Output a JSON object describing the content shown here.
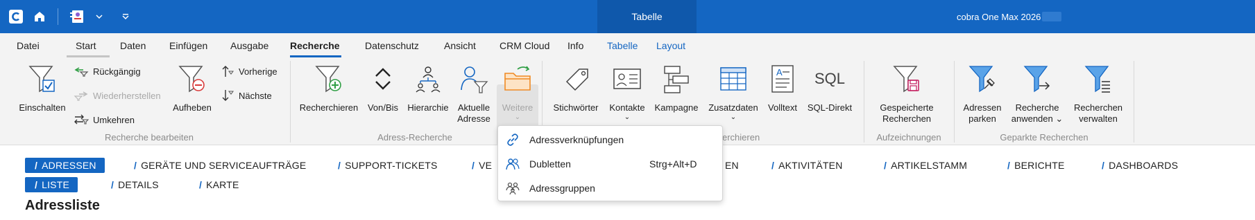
{
  "titlebar": {
    "context_header": "Tabelle",
    "app_title": "cobra One Max 2026"
  },
  "menu_tabs": [
    {
      "label": "Datei"
    },
    {
      "label": "Start"
    },
    {
      "label": "Daten"
    },
    {
      "label": "Einfügen"
    },
    {
      "label": "Ausgabe"
    },
    {
      "label": "Recherche"
    },
    {
      "label": "Datenschutz"
    },
    {
      "label": "Ansicht"
    },
    {
      "label": "CRM Cloud"
    },
    {
      "label": "Info"
    },
    {
      "label": "Tabelle"
    },
    {
      "label": "Layout"
    }
  ],
  "ribbon": {
    "recherche_bearbeiten": {
      "label": "Recherche bearbeiten",
      "einschalten": "Einschalten",
      "rueckgaengig": "Rückgängig",
      "wiederherstellen": "Wiederherstellen",
      "umkehren": "Umkehren",
      "aufheben": "Aufheben",
      "vorherige": "Vorherige",
      "naechste": "Nächste"
    },
    "adress_recherche": {
      "label": "Adress-Recherche",
      "recherchieren": "Recherchieren",
      "von_bis": "Von/Bis",
      "hierarchie": "Hierarchie",
      "aktuelle_adresse_1": "Aktuelle",
      "aktuelle_adresse_2": "Adresse",
      "weitere": "Weitere"
    },
    "weitere_recherchieren": {
      "label_visible": "erchieren",
      "stichwoerter": "Stichwörter",
      "kontakte": "Kontakte",
      "kampagne": "Kampagne",
      "zusatzdaten": "Zusatzdaten",
      "volltext": "Volltext",
      "sql_direkt": "SQL-Direkt",
      "sql_icon_text": "SQL"
    },
    "aufzeichnungen": {
      "label": "Aufzeichnungen",
      "gespeicherte_1": "Gespeicherte",
      "gespeicherte_2": "Recherchen"
    },
    "geparkte_recherchen": {
      "label": "Geparkte Recherchen",
      "adressen_parken_1": "Adressen",
      "adressen_parken_2": "parken",
      "recherche_anwenden_1": "Recherche",
      "recherche_anwenden_2": "anwenden",
      "recherchen_verwalten_1": "Recherchen",
      "recherchen_verwalten_2": "verwalten"
    }
  },
  "dropdown": {
    "items": [
      {
        "label": "Adressverknüpfungen",
        "shortcut": ""
      },
      {
        "label": "Dubletten",
        "shortcut": "Strg+Alt+D"
      },
      {
        "label": "Adressgruppen",
        "shortcut": ""
      }
    ]
  },
  "nav": {
    "primary": [
      {
        "label": "ADRESSEN"
      },
      {
        "label": "GERÄTE UND SERVICEAUFTRÄGE"
      },
      {
        "label": "SUPPORT-TICKETS"
      },
      {
        "label": "VE"
      },
      {
        "label": "EN"
      },
      {
        "label": "AKTIVITÄTEN"
      },
      {
        "label": "ARTIKELSTAMM"
      },
      {
        "label": "BERICHTE"
      },
      {
        "label": "DASHBOARDS"
      }
    ],
    "secondary": [
      {
        "label": "LISTE"
      },
      {
        "label": "DETAILS"
      },
      {
        "label": "KARTE"
      }
    ]
  },
  "page_title": "Adressliste",
  "colors": {
    "brand_blue": "#1466c2",
    "titlebar": "#1466c2",
    "ribbon_bg": "#f3f3f3",
    "accent_red": "#d93a3a",
    "accent_green": "#2f9e44",
    "accent_orange": "#f08a24"
  }
}
